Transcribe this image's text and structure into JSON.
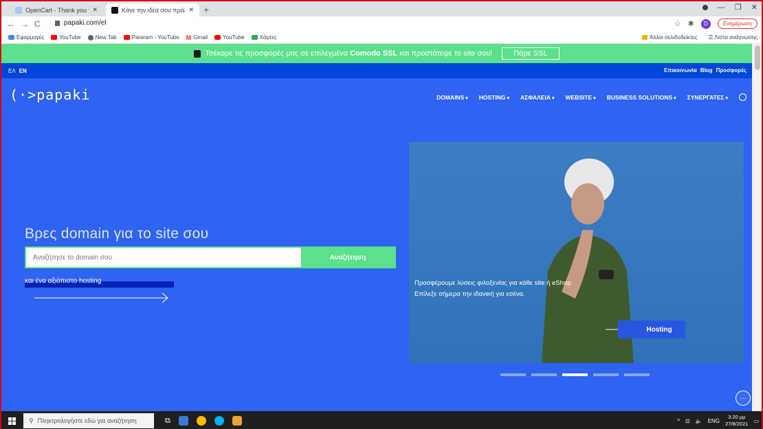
{
  "browser": {
    "tabs": [
      {
        "title": "OpenCart - Thank you for downl",
        "active": false
      },
      {
        "title": "Κάνε την ιδέα σου πράξη με ένα",
        "active": true
      }
    ],
    "new_tab": "+",
    "url": "papaki.com/el",
    "update_label": "Ενημέρωση",
    "avatar_letter": "D",
    "bookmarks": [
      {
        "label": "Εφαρμογές",
        "color": "#4285f4"
      },
      {
        "label": "YouTube",
        "color": "#ff0000"
      },
      {
        "label": "New Tab",
        "color": "#5f6368"
      },
      {
        "label": "Pararam - YouTube",
        "color": "#ff0000"
      },
      {
        "label": "Gmail",
        "color": "#d93025"
      },
      {
        "label": "YouTube",
        "color": "#ff0000"
      },
      {
        "label": "Χάρτες",
        "color": "#34a853"
      }
    ],
    "bookmarks_right": [
      "Άλλοι σελιδοδείκτες",
      "Λίστα ανάγνωσης"
    ]
  },
  "promo": {
    "text_before": "Τσέκαρε τις προσφορές μας σε επιλεγμένα ",
    "text_bold": "Comodo SSL",
    "text_after": " και προστάτεψε το site σου!",
    "button": "Πάρε SSL"
  },
  "topbar": {
    "lang_el": "ΕΛ",
    "lang_en": "EN",
    "links": [
      "Επικοινωνία",
      "Blog",
      "Προσφορές"
    ]
  },
  "logo": "(·>papaki",
  "menu": [
    {
      "label": "DOMAINS",
      "caret": "▾"
    },
    {
      "label": "HOSTING",
      "caret": "▾"
    },
    {
      "label": "ΑΣΦΑΛΕΙΑ",
      "caret": "▾"
    },
    {
      "label": "WEBSITE",
      "caret": "▾"
    },
    {
      "label": "BUSINESS SOLUTIONS",
      "caret": "▾"
    },
    {
      "label": "ΣΥΝΕΡΓΑΤΕΣ",
      "caret": "▾"
    }
  ],
  "hero": {
    "title": "Βρες domain για το site σου",
    "search_placeholder": "Αναζήτησε το domain σου",
    "search_button": "Αναζήτηση",
    "subline": "και ένα αξιόπιστο hosting"
  },
  "slide": {
    "text": "Προσφέρουμε λύσεις φιλοξενίας για κάθε site ή eShop. Επίλεξε σήμερα την ιδανική για εσένα.",
    "button": "Hosting",
    "active_index": 2,
    "count": 5
  },
  "taskbar": {
    "search_placeholder": "Πληκτρολογήστε εδώ για αναζήτηση",
    "lang": "ENG",
    "time": "3:20 μμ",
    "date": "27/8/2021"
  }
}
